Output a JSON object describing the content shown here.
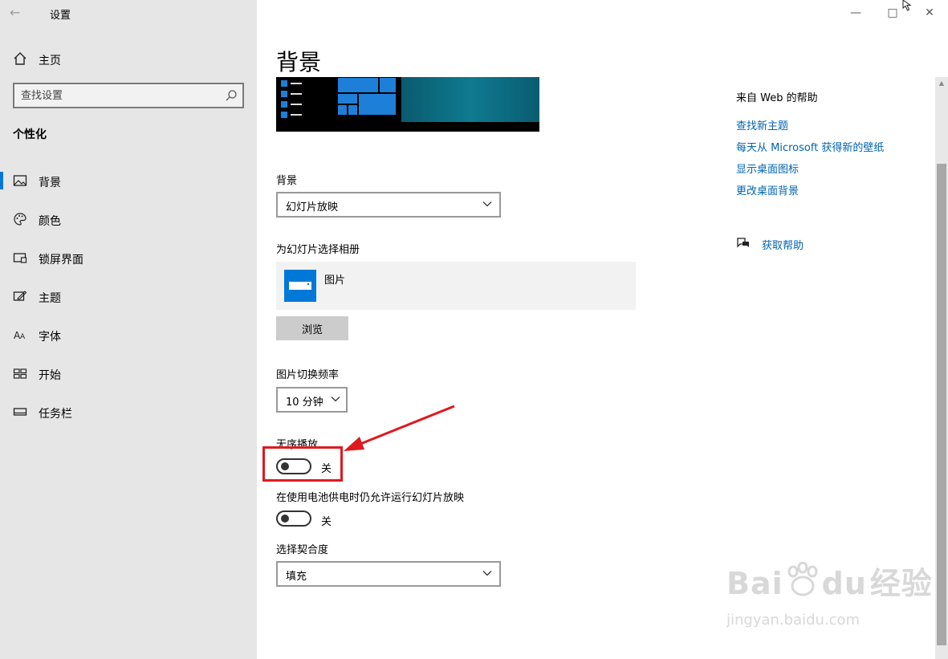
{
  "app": {
    "title": "设置"
  },
  "sidebar": {
    "home_label": "主页",
    "search_placeholder": "查找设置",
    "section_title": "个性化",
    "items": [
      {
        "label": "背景",
        "icon": "image-icon",
        "active": true
      },
      {
        "label": "颜色",
        "icon": "palette-icon"
      },
      {
        "label": "锁屏界面",
        "icon": "lock-screen-icon"
      },
      {
        "label": "主题",
        "icon": "theme-icon"
      },
      {
        "label": "字体",
        "icon": "font-icon"
      },
      {
        "label": "开始",
        "icon": "start-icon"
      },
      {
        "label": "任务栏",
        "icon": "taskbar-icon"
      }
    ]
  },
  "main": {
    "title": "背景",
    "background_label": "背景",
    "background_value": "幻灯片放映",
    "album_label": "为幻灯片选择相册",
    "album_name": "图片",
    "browse_label": "浏览",
    "interval_label": "图片切换频率",
    "interval_value": "10 分钟",
    "shuffle_label": "无序播放",
    "shuffle_state": "关",
    "battery_label": "在使用电池供电时仍允许运行幻灯片放映",
    "battery_state": "关",
    "fit_label": "选择契合度",
    "fit_value": "填充"
  },
  "help": {
    "title": "来自 Web 的帮助",
    "links": [
      "查找新主题",
      "每天从 Microsoft 获得新的壁纸",
      "显示桌面图标",
      "更改桌面背景"
    ],
    "get_help": "获取帮助"
  },
  "watermark": {
    "line1": "Bai",
    "line1b": "du",
    "line1c": "经验",
    "line2": "jingyan.baidu.com"
  },
  "colors": {
    "accent": "#0078d7",
    "link": "#0063b1",
    "highlight": "#e0191e"
  }
}
